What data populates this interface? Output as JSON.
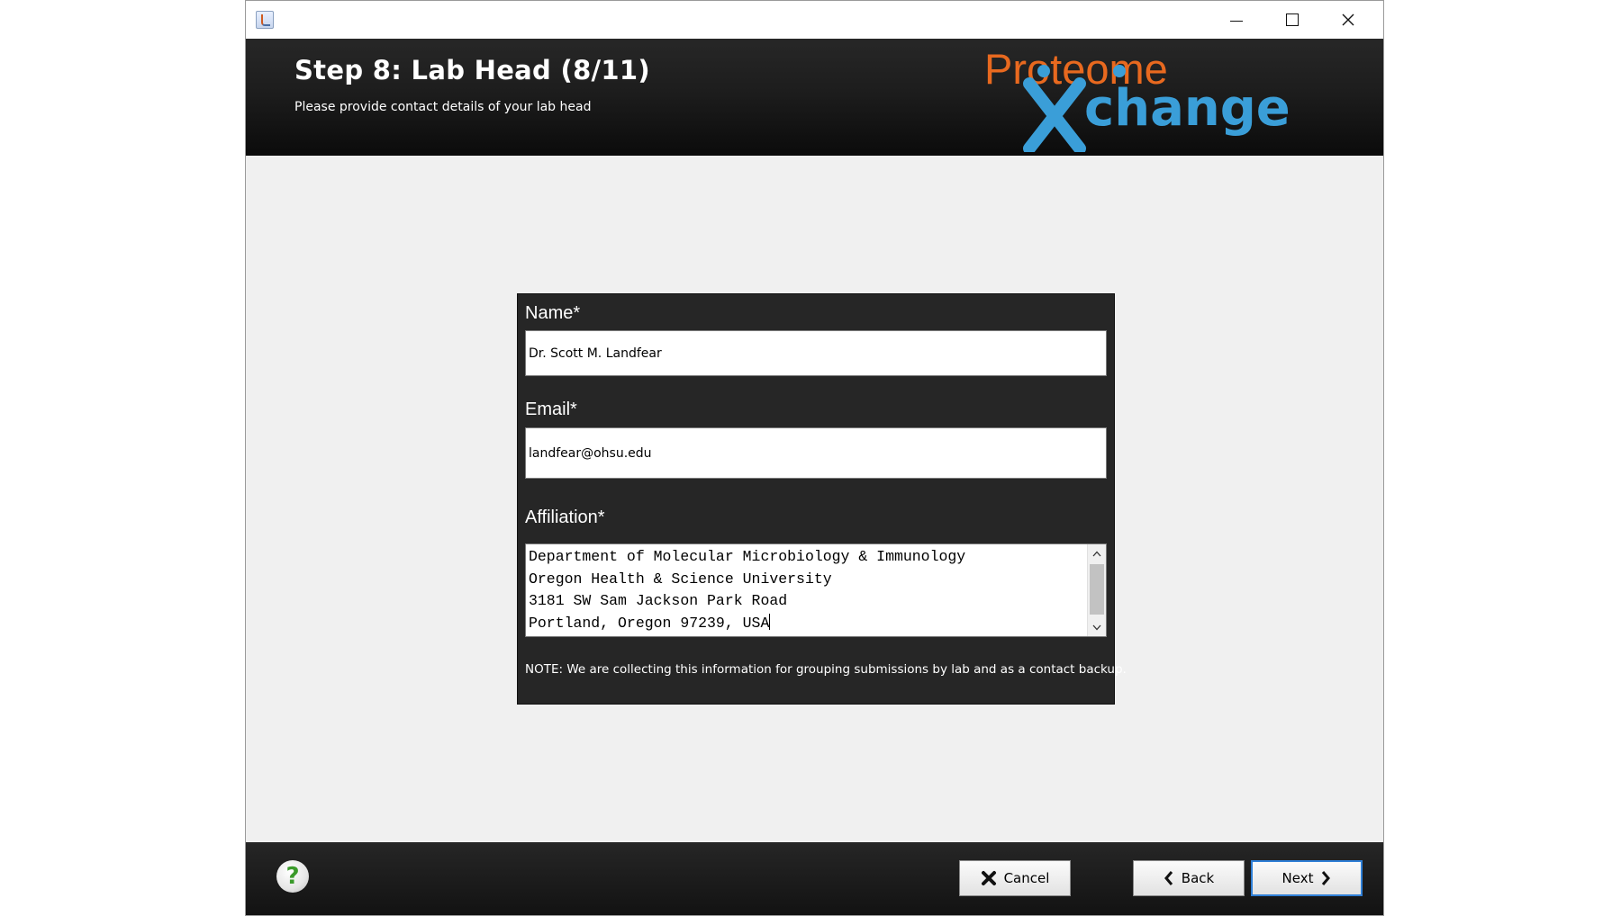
{
  "window": {
    "controls": {
      "minimize": "minimize-icon",
      "maximize": "maximize-icon",
      "close": "close-icon"
    }
  },
  "header": {
    "title": "Step 8: Lab Head (8/11)",
    "subtitle": "Please provide contact details of your lab head",
    "logo": {
      "line1": "Proteome",
      "line2": "Xchange",
      "orange": "#e8691f",
      "blue": "#3a9ed8"
    }
  },
  "form": {
    "name_label": "Name*",
    "name_value": "Dr. Scott M. Landfear",
    "email_label": "Email*",
    "email_value": "landfear@ohsu.edu",
    "affiliation_label": "Affiliation*",
    "affiliation_lines": [
      "Department of Molecular Microbiology & Immunology",
      "Oregon Health & Science University",
      "3181 SW Sam Jackson Park Road",
      "Portland, Oregon 97239, USA"
    ],
    "note": "NOTE: We are collecting this information for grouping submissions by lab and as a contact backup."
  },
  "footer": {
    "help_icon": "help-icon",
    "help_glyph": "?",
    "cancel_label": "Cancel",
    "back_label": "Back",
    "next_label": "Next"
  }
}
